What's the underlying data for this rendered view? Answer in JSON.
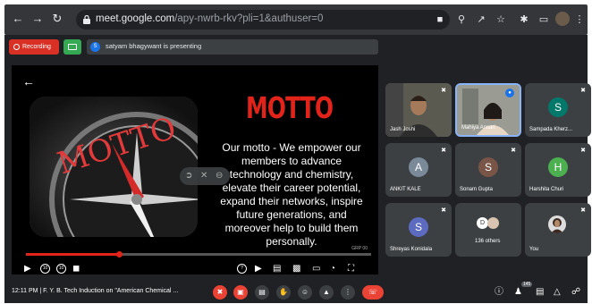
{
  "browser": {
    "url_host": "meet.google.com",
    "url_path": "/apy-nwrb-rkv?pli=1&authuser=0"
  },
  "meet_bar": {
    "recording_label": "Recording",
    "presenter_initial": "S",
    "presenting_text": "satyam bhagywant is presenting"
  },
  "presentation": {
    "title": "MOTTO",
    "image_text": "MOTTO",
    "body": "Our motto - We empower our members to advance technology and  chemistry, elevate their career potential, expand their networks, inspire future generations, and moreover help to build them personally.",
    "time_label": "GRP 00",
    "progress": 0.27
  },
  "participants": [
    {
      "name": "Jash Joshi",
      "type": "video",
      "speaking": false
    },
    {
      "name": "Mahiya Ansari",
      "type": "video",
      "speaking": true
    },
    {
      "name": "Sampada Kherz...",
      "initial": "S",
      "color": "#00796b"
    },
    {
      "name": "ANKIT KALE",
      "initial": "A",
      "color": "#7a8a99"
    },
    {
      "name": "Sonam Gupta",
      "initial": "S",
      "color": "#795548"
    },
    {
      "name": "Harshita Churi",
      "initial": "H",
      "color": "#4caf50"
    },
    {
      "name": "Shreyas Konidala",
      "initial": "S",
      "color": "#5c6bc0"
    },
    {
      "name": "136 others",
      "initial": "D",
      "color": "#ffffff"
    },
    {
      "name": "You",
      "type": "avatar"
    }
  ],
  "bottom_bar": {
    "meeting_info": "12:11 PM  |  F. Y. B. Tech Induction on \"American Chemical ...",
    "participant_count": "145"
  },
  "colors": {
    "accent_red": "#ea4335",
    "motto_red": "#e2231a",
    "recording_red": "#d93025",
    "present_green": "#34a853"
  }
}
